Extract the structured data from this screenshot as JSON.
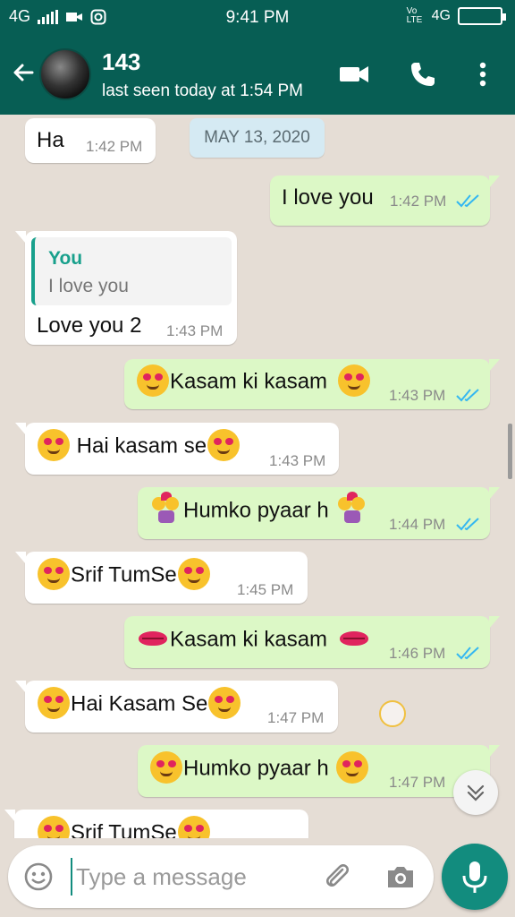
{
  "status_bar": {
    "network_left": "4G",
    "time": "9:41 PM",
    "volte": "Vo LTE",
    "network_right": "4G"
  },
  "header": {
    "contact_name": "143",
    "last_seen": "last seen today at 1:54 PM"
  },
  "date_chip": "MAY 13, 2020",
  "messages": [
    {
      "direction": "in",
      "text": "Ha",
      "time": "1:42 PM"
    },
    {
      "direction": "out",
      "text": "I love you",
      "time": "1:42 PM"
    },
    {
      "direction": "in",
      "quote_author": "You",
      "quote_text": "I love you",
      "text": "Love you 2",
      "time": "1:43 PM"
    },
    {
      "direction": "out",
      "text": "Kasam ki kasam",
      "emoji": "smiling-face-with-hearts",
      "time": "1:43 PM"
    },
    {
      "direction": "in",
      "text": " Hai kasam se",
      "emoji": "heart-eyes",
      "time": "1:43 PM"
    },
    {
      "direction": "out",
      "text": "Humko pyaar h",
      "emoji": "couple-with-heart",
      "time": "1:44 PM"
    },
    {
      "direction": "in",
      "text": "Srif TumSe",
      "emoji": "face-blowing-kiss",
      "time": "1:45 PM"
    },
    {
      "direction": "out",
      "text": "Kasam ki kasam",
      "emoji": "kiss-mark",
      "time": "1:46 PM"
    },
    {
      "direction": "in",
      "text": "Hai Kasam Se",
      "emoji": "smiling-face-with-hearts",
      "time": "1:47 PM"
    },
    {
      "direction": "out",
      "text": "Humko pyaar h",
      "emoji": "kissing-smiling-face",
      "time": "1:47 PM"
    },
    {
      "direction": "in",
      "text": "Srif TumSe",
      "emoji": "face-blowing-kiss",
      "time": ""
    }
  ],
  "composer": {
    "placeholder": "Type a message"
  },
  "colors": {
    "header": "#075e54",
    "outgoing_bubble": "#dcf8c6",
    "incoming_bubble": "#ffffff",
    "wallpaper": "#e5ddd5",
    "accent": "#128c7e",
    "read_ticks": "#34b7f1"
  },
  "icons": [
    "arrow-back-icon",
    "video-call-icon",
    "phone-icon",
    "more-vert-icon",
    "double-check-icon",
    "scroll-down-icon",
    "emoji-icon",
    "attach-icon",
    "camera-icon",
    "mic-icon"
  ]
}
